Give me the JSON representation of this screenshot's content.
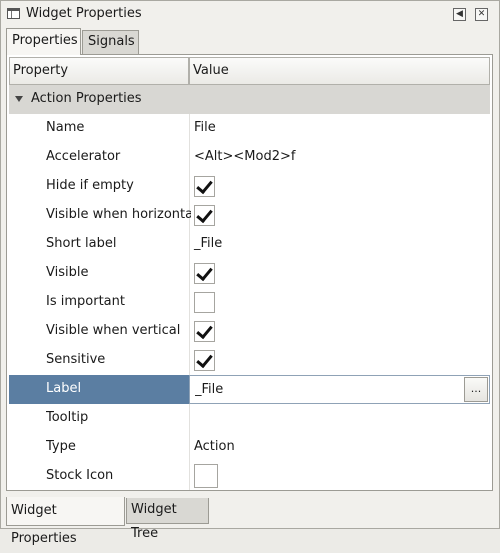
{
  "window": {
    "title": "Widget Properties",
    "icon": "window-icon",
    "buttons": [
      "restore-icon",
      "close-icon"
    ]
  },
  "top_tabs": [
    {
      "label": "Properties",
      "active": true
    },
    {
      "label": "Signals",
      "active": false
    }
  ],
  "table": {
    "headers": {
      "property": "Property",
      "value": "Value"
    },
    "section": {
      "label": "Action Properties",
      "expanded": true
    },
    "rows": [
      {
        "name": "Name",
        "kind": "text",
        "value": "File"
      },
      {
        "name": "Accelerator",
        "kind": "text",
        "value": "<Alt><Mod2>f"
      },
      {
        "name": "Hide if empty",
        "kind": "check",
        "checked": true
      },
      {
        "name": "Visible when horizontal",
        "kind": "check",
        "checked": true
      },
      {
        "name": "Short label",
        "kind": "text",
        "value": "_File"
      },
      {
        "name": "Visible",
        "kind": "check",
        "checked": true
      },
      {
        "name": "Is important",
        "kind": "check",
        "checked": false
      },
      {
        "name": "Visible when vertical",
        "kind": "check",
        "checked": true
      },
      {
        "name": "Sensitive",
        "kind": "check",
        "checked": true
      },
      {
        "name": "Label",
        "kind": "edit",
        "value": "_File",
        "button": "...",
        "selected": true
      },
      {
        "name": "Tooltip",
        "kind": "text",
        "value": ""
      },
      {
        "name": "Type",
        "kind": "text",
        "value": "Action"
      },
      {
        "name": "Stock Icon",
        "kind": "stock",
        "value": ""
      }
    ]
  },
  "bottom_tabs": [
    {
      "label": "Widget Properties",
      "active": true
    },
    {
      "label": "Widget Tree",
      "active": false
    }
  ],
  "colors": {
    "selection": "#5b7ea2",
    "section_bg": "#d8d7d3",
    "window_bg": "#ecebe7"
  }
}
